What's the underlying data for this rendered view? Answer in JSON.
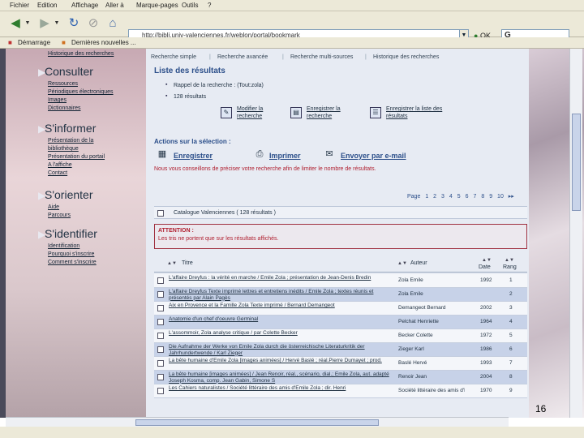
{
  "menubar": {
    "items": [
      "Fichier",
      "Edition",
      "Affichage",
      "Aller à",
      "Marque-pages",
      "Outils",
      "?"
    ]
  },
  "navbar": {
    "url": "http://bibli.univ-valenciennes.fr/weblon/portal/bookmark",
    "go_label": "OK",
    "search_text": "G"
  },
  "bookmarks": {
    "items": [
      "Démarrage",
      "Dernières nouvelles ..."
    ]
  },
  "sidebar": {
    "top_link": "Historique des recherches",
    "sections": [
      {
        "title": "Consulter",
        "links": [
          "Ressources",
          "Périodiques électroniques",
          "Images",
          "Dictionnaires"
        ]
      },
      {
        "title": "S'informer",
        "links": [
          "Présentation de la",
          "bibliothèque",
          "Présentation du portail",
          "A l'affiche",
          "Contact"
        ]
      },
      {
        "title": "S'orienter",
        "links": [
          "Aide",
          "Parcours"
        ]
      },
      {
        "title": "S'identifier",
        "links": [
          "Identification",
          "Pourquoi s'inscrire",
          "Comment s'inscrire"
        ]
      }
    ]
  },
  "tabs": [
    "Recherche simple",
    "Recherche avancée",
    "Recherche multi-sources",
    "Historique des recherches"
  ],
  "results": {
    "heading": "Liste des résultats",
    "info": [
      "Rappel de la recherche : (Tout:zola)",
      "128 résultats"
    ],
    "actions": [
      {
        "label": "Modifier la recherche",
        "icon": "edit-icon"
      },
      {
        "label": "Enregistrer la recherche",
        "icon": "save-icon"
      },
      {
        "label": "Enregistrer la liste des résultats",
        "icon": "list-icon"
      }
    ]
  },
  "selection": {
    "heading": "Actions sur la sélection :",
    "actions": [
      {
        "label": "Enregistrer",
        "icon": "disk-icon"
      },
      {
        "label": "Imprimer",
        "icon": "printer-icon"
      },
      {
        "label": "Envoyer par e-mail",
        "icon": "mail-icon"
      }
    ],
    "hint": "Nous vous conseillons de préciser votre recherche afin de limiter le nombre de résultats."
  },
  "pager": {
    "label": "Page",
    "pages": [
      "1",
      "2",
      "3",
      "4",
      "5",
      "6",
      "7",
      "8",
      "9",
      "10"
    ],
    "next": "▸▸"
  },
  "catalogue": "Catalogue Valenciennes ( 128 résultats )",
  "attention": {
    "title": "ATTENTION :",
    "message": "Les tris ne portent que sur les résultats affichés."
  },
  "table": {
    "headers": {
      "title": "Titre",
      "author": "Auteur",
      "date": "Date",
      "rank": "Rang"
    },
    "rows": [
      {
        "title": "L'affaire Dreyfus : la vérité en marche / Emile Zola ; présentation de Jean-Denis Bredin",
        "author": "Zola Emile",
        "date": "1992",
        "rank": "1",
        "style": "white"
      },
      {
        "title": "L'affaire Dreyfus Texte imprimé lettres et entretiens inédits / Emile Zola ; textes réunis et présentés par Alain Pagès",
        "author": "Zola Emile",
        "date": "",
        "rank": "2",
        "style": "alt"
      },
      {
        "title": "Aix en Provence et la Famille Zola Texte imprimé / Bernard Demangeot",
        "author": "Demangeot Bernard",
        "date": "2002",
        "rank": "3",
        "style": "white"
      },
      {
        "title": "Anatomie d'un chef d'oeuvre Germinal",
        "author": "Pelchat Henriette",
        "date": "1964",
        "rank": "4",
        "style": "alt"
      },
      {
        "title": "L'assommoir, Zola analyse critique / par Colette Becker",
        "author": "Becker Colette",
        "date": "1972",
        "rank": "5",
        "style": "white"
      },
      {
        "title": "Die Aufnahme der Werke von Emile Zola durch die österreichische Literaturkritik der Jahrhundertwende / Karl Zieger",
        "author": "Zieger Karl",
        "date": "1986",
        "rank": "6",
        "style": "alt"
      },
      {
        "title": "La bête humaine d'Emile Zola [images animées] / Hervé Baslé ; réal.Pierre Dumayet ; prod.",
        "author": "Baslé Hervé",
        "date": "1993",
        "rank": "7",
        "style": "white"
      },
      {
        "title": "La bête humaine [images animées] / Jean Renoir, réal., scénario, dial.; Emile Zola, aut. adapté Joseph Kosma, comp. Jean Gabin, Simone S",
        "author": "Renoir Jean",
        "date": "2004",
        "rank": "8",
        "style": "alt"
      },
      {
        "title": "Les Cahiers naturalistes / Société littéraire des amis d'Emile Zola ; dir. Henri",
        "author": "Société littéraire des amis d'Emile Zola",
        "date": "1970",
        "rank": "9",
        "style": "white"
      }
    ]
  },
  "slide_number": "16"
}
